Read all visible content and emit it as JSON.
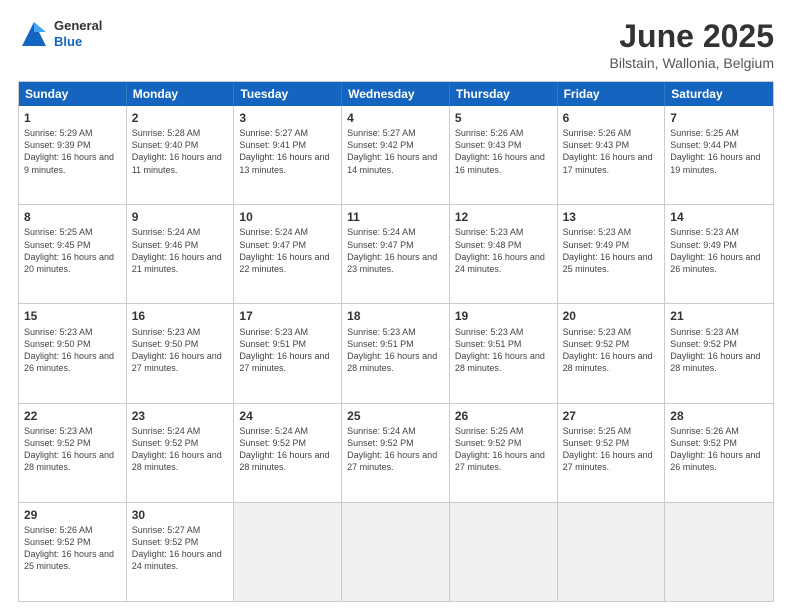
{
  "header": {
    "logo_general": "General",
    "logo_blue": "Blue",
    "title": "June 2025",
    "location": "Bilstain, Wallonia, Belgium"
  },
  "weekdays": [
    "Sunday",
    "Monday",
    "Tuesday",
    "Wednesday",
    "Thursday",
    "Friday",
    "Saturday"
  ],
  "rows": [
    [
      {
        "day": "1",
        "sunrise": "Sunrise: 5:29 AM",
        "sunset": "Sunset: 9:39 PM",
        "daylight": "Daylight: 16 hours and 9 minutes."
      },
      {
        "day": "2",
        "sunrise": "Sunrise: 5:28 AM",
        "sunset": "Sunset: 9:40 PM",
        "daylight": "Daylight: 16 hours and 11 minutes."
      },
      {
        "day": "3",
        "sunrise": "Sunrise: 5:27 AM",
        "sunset": "Sunset: 9:41 PM",
        "daylight": "Daylight: 16 hours and 13 minutes."
      },
      {
        "day": "4",
        "sunrise": "Sunrise: 5:27 AM",
        "sunset": "Sunset: 9:42 PM",
        "daylight": "Daylight: 16 hours and 14 minutes."
      },
      {
        "day": "5",
        "sunrise": "Sunrise: 5:26 AM",
        "sunset": "Sunset: 9:43 PM",
        "daylight": "Daylight: 16 hours and 16 minutes."
      },
      {
        "day": "6",
        "sunrise": "Sunrise: 5:26 AM",
        "sunset": "Sunset: 9:43 PM",
        "daylight": "Daylight: 16 hours and 17 minutes."
      },
      {
        "day": "7",
        "sunrise": "Sunrise: 5:25 AM",
        "sunset": "Sunset: 9:44 PM",
        "daylight": "Daylight: 16 hours and 19 minutes."
      }
    ],
    [
      {
        "day": "8",
        "sunrise": "Sunrise: 5:25 AM",
        "sunset": "Sunset: 9:45 PM",
        "daylight": "Daylight: 16 hours and 20 minutes."
      },
      {
        "day": "9",
        "sunrise": "Sunrise: 5:24 AM",
        "sunset": "Sunset: 9:46 PM",
        "daylight": "Daylight: 16 hours and 21 minutes."
      },
      {
        "day": "10",
        "sunrise": "Sunrise: 5:24 AM",
        "sunset": "Sunset: 9:47 PM",
        "daylight": "Daylight: 16 hours and 22 minutes."
      },
      {
        "day": "11",
        "sunrise": "Sunrise: 5:24 AM",
        "sunset": "Sunset: 9:47 PM",
        "daylight": "Daylight: 16 hours and 23 minutes."
      },
      {
        "day": "12",
        "sunrise": "Sunrise: 5:23 AM",
        "sunset": "Sunset: 9:48 PM",
        "daylight": "Daylight: 16 hours and 24 minutes."
      },
      {
        "day": "13",
        "sunrise": "Sunrise: 5:23 AM",
        "sunset": "Sunset: 9:49 PM",
        "daylight": "Daylight: 16 hours and 25 minutes."
      },
      {
        "day": "14",
        "sunrise": "Sunrise: 5:23 AM",
        "sunset": "Sunset: 9:49 PM",
        "daylight": "Daylight: 16 hours and 26 minutes."
      }
    ],
    [
      {
        "day": "15",
        "sunrise": "Sunrise: 5:23 AM",
        "sunset": "Sunset: 9:50 PM",
        "daylight": "Daylight: 16 hours and 26 minutes."
      },
      {
        "day": "16",
        "sunrise": "Sunrise: 5:23 AM",
        "sunset": "Sunset: 9:50 PM",
        "daylight": "Daylight: 16 hours and 27 minutes."
      },
      {
        "day": "17",
        "sunrise": "Sunrise: 5:23 AM",
        "sunset": "Sunset: 9:51 PM",
        "daylight": "Daylight: 16 hours and 27 minutes."
      },
      {
        "day": "18",
        "sunrise": "Sunrise: 5:23 AM",
        "sunset": "Sunset: 9:51 PM",
        "daylight": "Daylight: 16 hours and 28 minutes."
      },
      {
        "day": "19",
        "sunrise": "Sunrise: 5:23 AM",
        "sunset": "Sunset: 9:51 PM",
        "daylight": "Daylight: 16 hours and 28 minutes."
      },
      {
        "day": "20",
        "sunrise": "Sunrise: 5:23 AM",
        "sunset": "Sunset: 9:52 PM",
        "daylight": "Daylight: 16 hours and 28 minutes."
      },
      {
        "day": "21",
        "sunrise": "Sunrise: 5:23 AM",
        "sunset": "Sunset: 9:52 PM",
        "daylight": "Daylight: 16 hours and 28 minutes."
      }
    ],
    [
      {
        "day": "22",
        "sunrise": "Sunrise: 5:23 AM",
        "sunset": "Sunset: 9:52 PM",
        "daylight": "Daylight: 16 hours and 28 minutes."
      },
      {
        "day": "23",
        "sunrise": "Sunrise: 5:24 AM",
        "sunset": "Sunset: 9:52 PM",
        "daylight": "Daylight: 16 hours and 28 minutes."
      },
      {
        "day": "24",
        "sunrise": "Sunrise: 5:24 AM",
        "sunset": "Sunset: 9:52 PM",
        "daylight": "Daylight: 16 hours and 28 minutes."
      },
      {
        "day": "25",
        "sunrise": "Sunrise: 5:24 AM",
        "sunset": "Sunset: 9:52 PM",
        "daylight": "Daylight: 16 hours and 27 minutes."
      },
      {
        "day": "26",
        "sunrise": "Sunrise: 5:25 AM",
        "sunset": "Sunset: 9:52 PM",
        "daylight": "Daylight: 16 hours and 27 minutes."
      },
      {
        "day": "27",
        "sunrise": "Sunrise: 5:25 AM",
        "sunset": "Sunset: 9:52 PM",
        "daylight": "Daylight: 16 hours and 27 minutes."
      },
      {
        "day": "28",
        "sunrise": "Sunrise: 5:26 AM",
        "sunset": "Sunset: 9:52 PM",
        "daylight": "Daylight: 16 hours and 26 minutes."
      }
    ],
    [
      {
        "day": "29",
        "sunrise": "Sunrise: 5:26 AM",
        "sunset": "Sunset: 9:52 PM",
        "daylight": "Daylight: 16 hours and 25 minutes."
      },
      {
        "day": "30",
        "sunrise": "Sunrise: 5:27 AM",
        "sunset": "Sunset: 9:52 PM",
        "daylight": "Daylight: 16 hours and 24 minutes."
      },
      {
        "day": "",
        "sunrise": "",
        "sunset": "",
        "daylight": ""
      },
      {
        "day": "",
        "sunrise": "",
        "sunset": "",
        "daylight": ""
      },
      {
        "day": "",
        "sunrise": "",
        "sunset": "",
        "daylight": ""
      },
      {
        "day": "",
        "sunrise": "",
        "sunset": "",
        "daylight": ""
      },
      {
        "day": "",
        "sunrise": "",
        "sunset": "",
        "daylight": ""
      }
    ]
  ]
}
